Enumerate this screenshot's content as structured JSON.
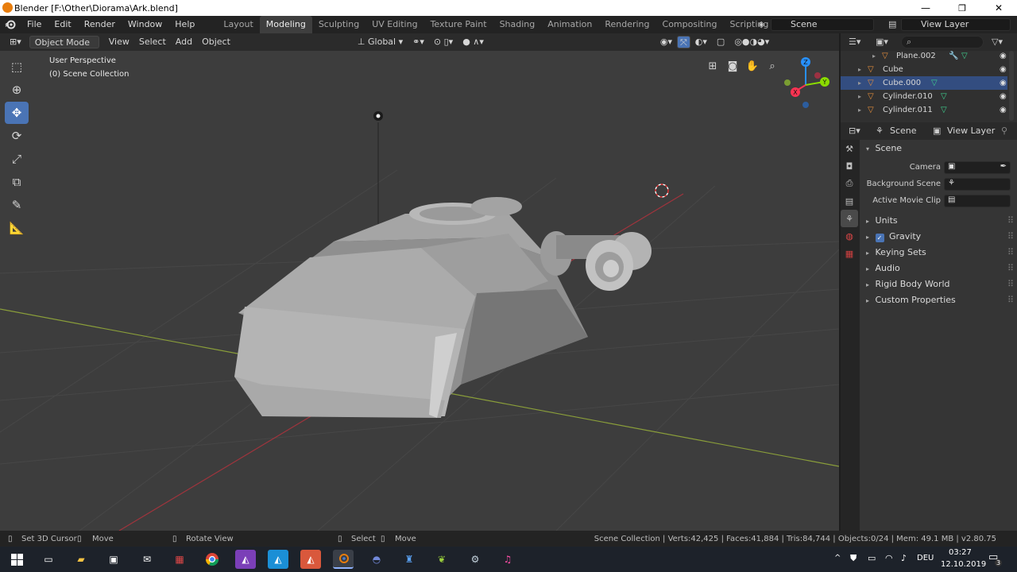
{
  "window": {
    "title": "Blender [F:\\Other\\Diorama\\Ark.blend]",
    "minimize": "—",
    "maximize": "❐",
    "close": "✕"
  },
  "menu": [
    "File",
    "Edit",
    "Render",
    "Window",
    "Help"
  ],
  "workspaces": [
    "Layout",
    "Modeling",
    "Sculpting",
    "UV Editing",
    "Texture Paint",
    "Shading",
    "Animation",
    "Rendering",
    "Compositing",
    "Scripting"
  ],
  "active_workspace": "Modeling",
  "add_workspace": "+",
  "scene": {
    "name": "Scene",
    "view_layer": "View Layer"
  },
  "viewport_header": {
    "mode": "Object Mode",
    "menus": [
      "View",
      "Select",
      "Add",
      "Object"
    ],
    "transform_orientation": "Global"
  },
  "viewport": {
    "perspective": "User Perspective",
    "collection": "(0) Scene Collection"
  },
  "gizmo": {
    "z": "Z",
    "y": "Y",
    "x": "X"
  },
  "outliner": {
    "items": [
      {
        "name": "Plane.002",
        "selected": false
      },
      {
        "name": "Cube",
        "selected": false
      },
      {
        "name": "Cube.000",
        "selected": true
      },
      {
        "name": "Cylinder.010",
        "selected": false
      },
      {
        "name": "Cylinder.011",
        "selected": false
      }
    ]
  },
  "properties": {
    "tabs": {
      "scene": "Scene",
      "view_layer": "View Layer"
    },
    "panel_title": "Scene",
    "fields": [
      {
        "label": "Camera"
      },
      {
        "label": "Background Scene"
      },
      {
        "label": "Active Movie Clip"
      }
    ],
    "panels": [
      "Units",
      "Gravity",
      "Keying Sets",
      "Audio",
      "Rigid Body World",
      "Custom Properties"
    ],
    "gravity_checked": true
  },
  "status": {
    "left": [
      {
        "label": "Set 3D Cursor"
      },
      {
        "label": "Move"
      },
      {
        "label": "Rotate View"
      },
      {
        "label": "Select"
      },
      {
        "label": "Move"
      }
    ],
    "right": "Scene Collection | Verts:42,425 | Faces:41,884 | Tris:84,744 | Objects:0/24 | Mem: 49.1 MB | v2.80.75"
  },
  "taskbar": {
    "language": "DEU",
    "time": "03:27",
    "date": "12.10.2019",
    "notification_count": "3"
  },
  "colors": {
    "accent": "#4a74b5",
    "selection": "#334d80",
    "blender_orange": "#e87d0d",
    "x_axis": "#ff3352",
    "y_axis": "#8bdc00",
    "z_axis": "#2890ff"
  }
}
